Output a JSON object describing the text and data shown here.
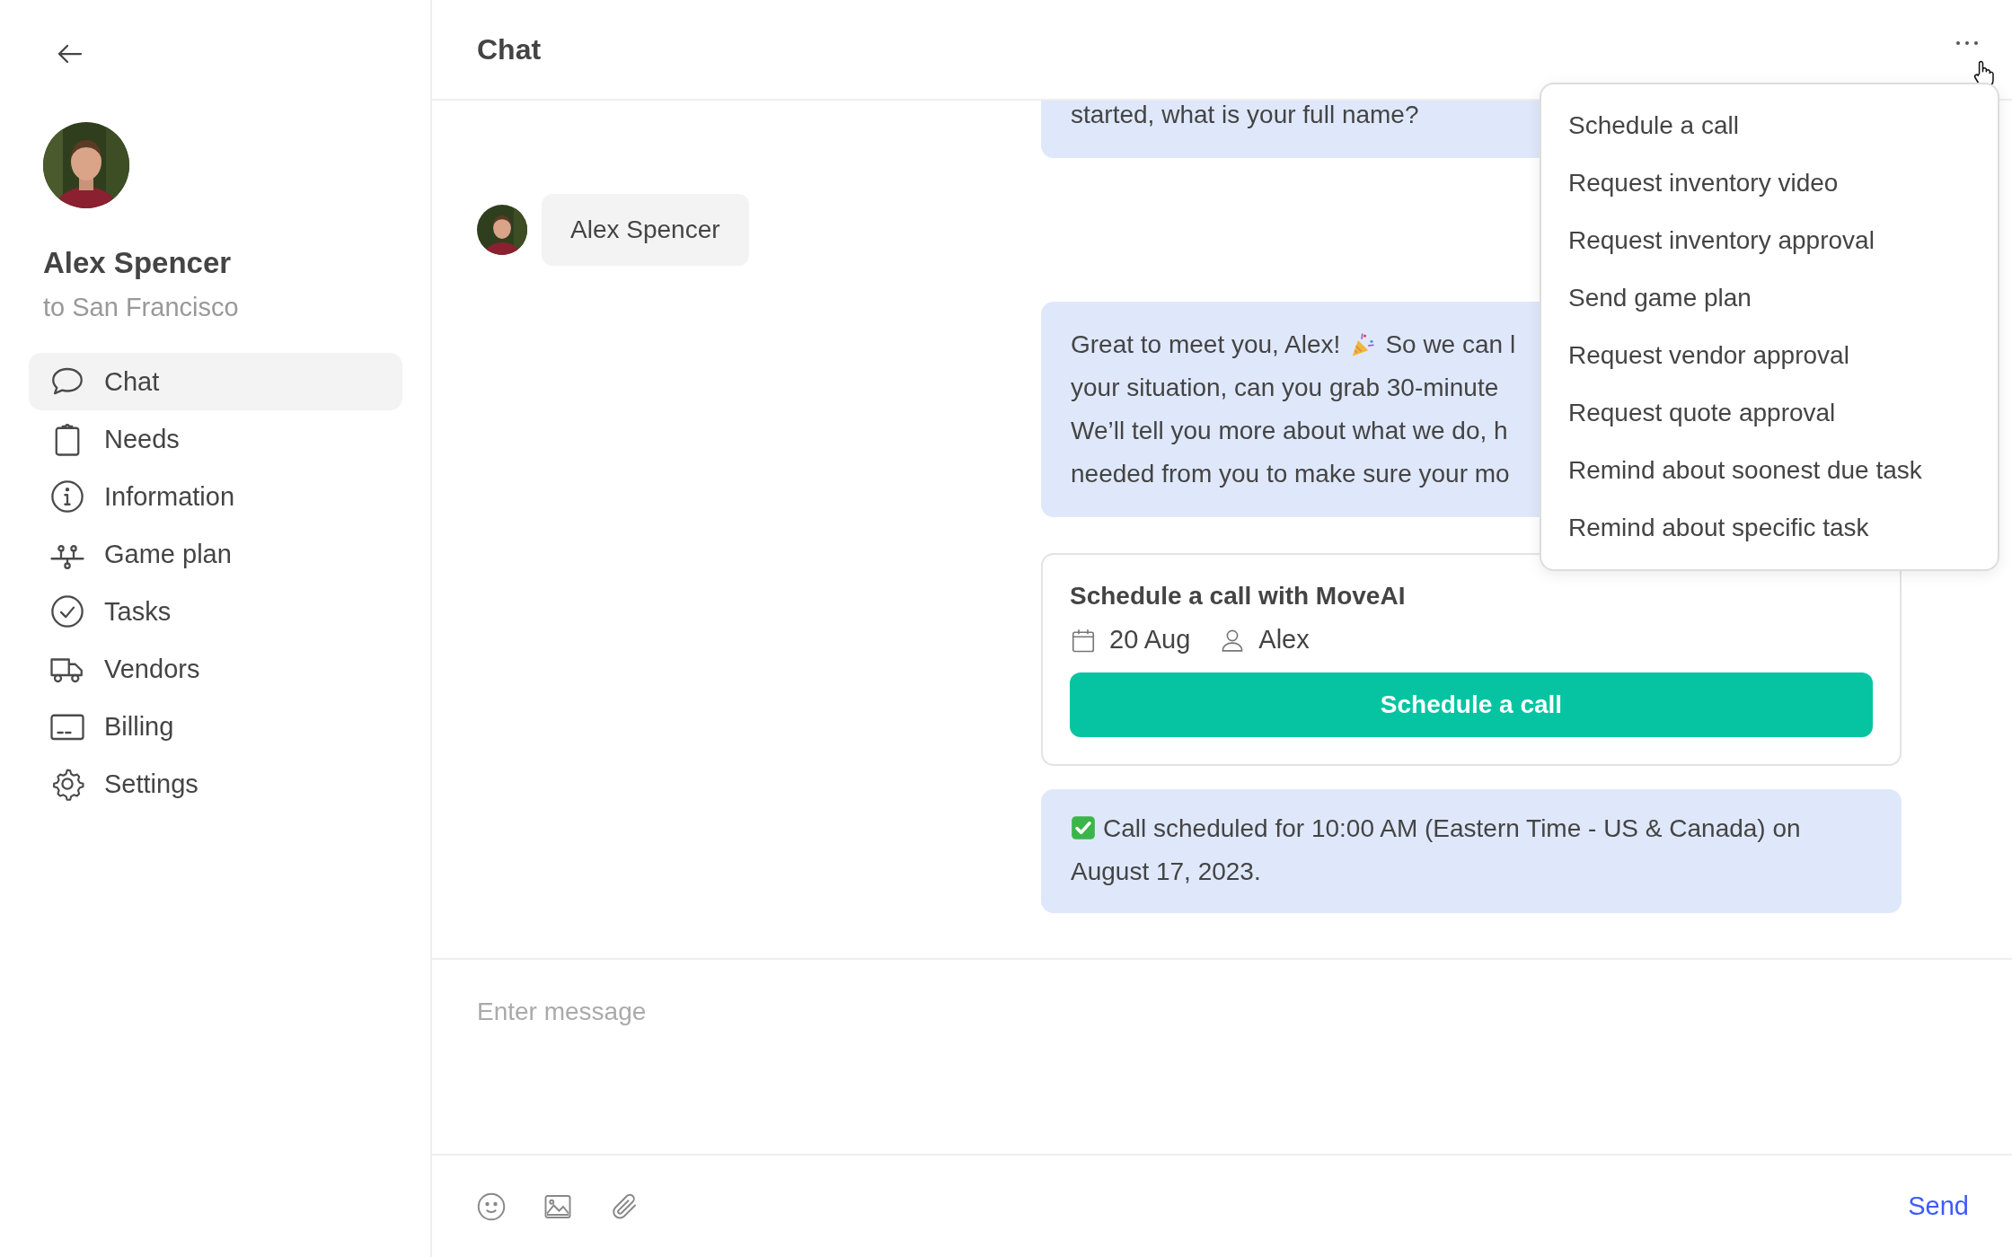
{
  "sidebar": {
    "profile": {
      "name": "Alex Spencer",
      "subtitle": "to San Francisco"
    },
    "nav": [
      {
        "label": "Chat",
        "kind": "chat",
        "selected": true
      },
      {
        "label": "Needs",
        "kind": "clipboard",
        "selected": false
      },
      {
        "label": "Information",
        "kind": "info",
        "selected": false
      },
      {
        "label": "Game plan",
        "kind": "plan",
        "selected": false
      },
      {
        "label": "Tasks",
        "kind": "check",
        "selected": false
      },
      {
        "label": "Vendors",
        "kind": "truck",
        "selected": false
      },
      {
        "label": "Billing",
        "kind": "billing",
        "selected": false
      },
      {
        "label": "Settings",
        "kind": "gear",
        "selected": false
      }
    ]
  },
  "header": {
    "title": "Chat"
  },
  "messages": [
    {
      "kind": "bot_text",
      "lines": [
        [
          "started, what is your full name?"
        ]
      ]
    },
    {
      "kind": "user",
      "text": "Alex Spencer"
    },
    {
      "kind": "bot_text",
      "lines": [
        [
          "Great to meet you, Alex!",
          "So we can l"
        ],
        [
          "your situation, can you grab 30-minute"
        ],
        [
          "We’ll tell you more about what we do, h"
        ],
        [
          "needed from you to make sure your mo"
        ]
      ]
    },
    {
      "kind": "card",
      "title": "Schedule a call with MoveAI",
      "date": "20 Aug",
      "person": "Alex",
      "button": "Schedule a call"
    },
    {
      "kind": "confirmation",
      "text": "Call scheduled for 10:00 AM (Eastern Time - US & Canada) on August 17, 2023."
    }
  ],
  "menu": {
    "items": [
      "Schedule a call",
      "Request inventory video",
      "Request inventory approval",
      "Send game plan",
      "Request vendor approval",
      "Request quote approval",
      "Remind about soonest due task",
      "Remind about specific task"
    ]
  },
  "composer": {
    "placeholder": "Enter message",
    "send": "Send"
  }
}
